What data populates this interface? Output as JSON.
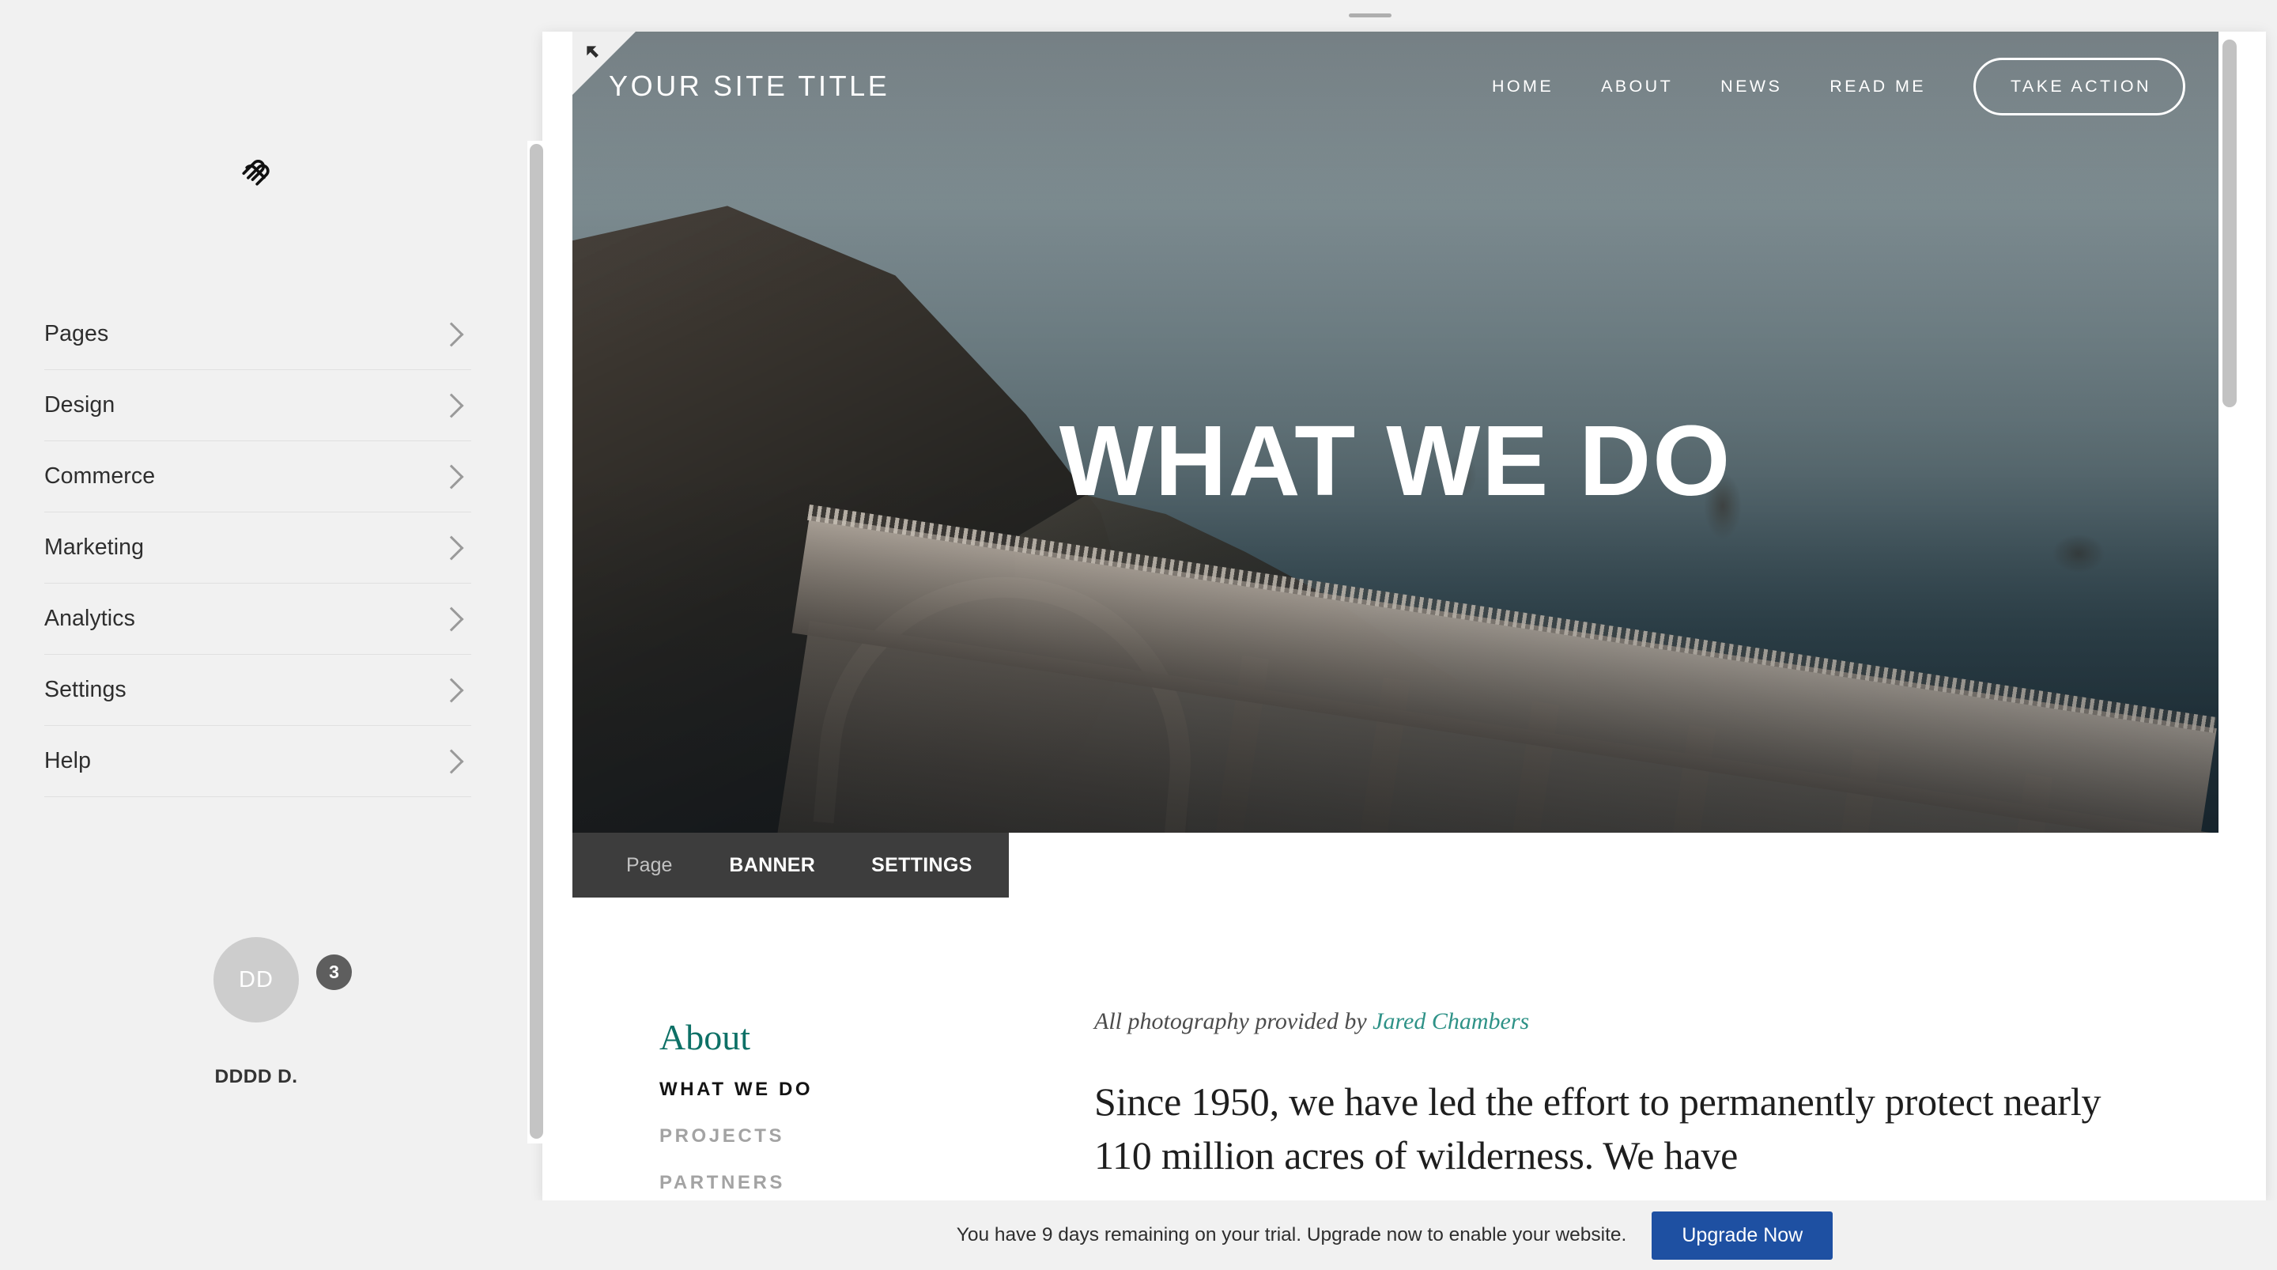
{
  "sidebar": {
    "logo_icon": "squarespace-logo-icon",
    "items": [
      {
        "label": "Pages",
        "icon": "chevron-right-icon"
      },
      {
        "label": "Design",
        "icon": "chevron-right-icon"
      },
      {
        "label": "Commerce",
        "icon": "chevron-right-icon"
      },
      {
        "label": "Marketing",
        "icon": "chevron-right-icon"
      },
      {
        "label": "Analytics",
        "icon": "chevron-right-icon"
      },
      {
        "label": "Settings",
        "icon": "chevron-right-icon"
      },
      {
        "label": "Help",
        "icon": "chevron-right-icon"
      }
    ],
    "account": {
      "avatar_initials": "DD",
      "notification_count": "3",
      "name": "DDDD D."
    }
  },
  "preview": {
    "corner_icon": "arrow-up-left-icon",
    "site": {
      "title": "YOUR SITE TITLE",
      "nav": [
        {
          "label": "HOME"
        },
        {
          "label": "ABOUT"
        },
        {
          "label": "NEWS"
        },
        {
          "label": "READ ME"
        }
      ],
      "cta_label": "TAKE ACTION",
      "hero_title": "WHAT WE DO"
    },
    "toolbar": {
      "page_label": "Page",
      "banner_label": "BANNER",
      "settings_label": "SETTINGS"
    },
    "body": {
      "section_heading": "About",
      "subnav": [
        {
          "label": "WHAT WE DO",
          "state": "active"
        },
        {
          "label": "PROJECTS",
          "state": "muted"
        },
        {
          "label": "PARTNERS",
          "state": "muted"
        }
      ],
      "photo_credit_prefix": "All photography provided by ",
      "photo_credit_link": "Jared Chambers",
      "paragraph": "Since 1950, we have led the effort to permanently protect nearly 110 million acres of wilderness. We have"
    }
  },
  "trial": {
    "message": "You have 9 days remaining on your trial. Upgrade now to enable your website.",
    "upgrade_label": "Upgrade Now"
  },
  "colors": {
    "accent_teal": "#0d7066",
    "link_teal": "#2e9287",
    "upgrade_blue": "#1e50a2",
    "toolbar_dark": "#3d3d3d",
    "sidebar_bg": "#f1f1f1"
  }
}
